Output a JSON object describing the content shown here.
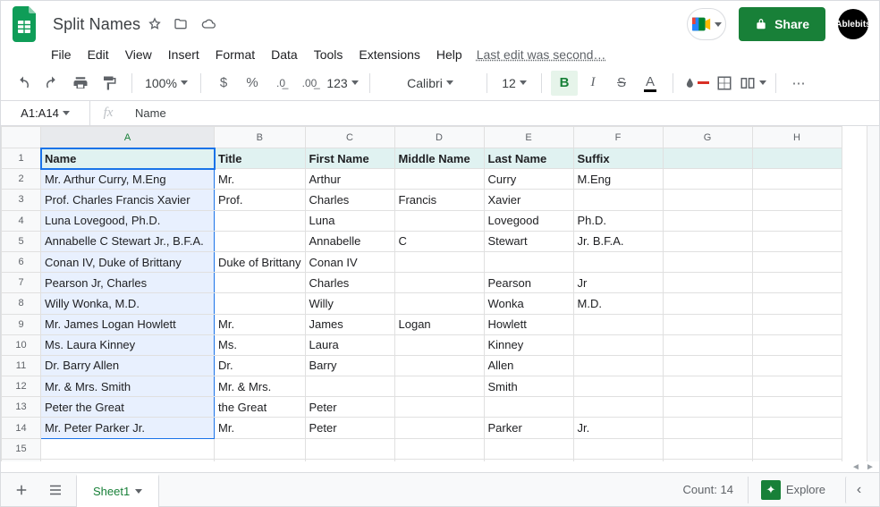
{
  "doc": {
    "title": "Split Names",
    "last_edit": "Last edit was second…"
  },
  "menu": {
    "file": "File",
    "edit": "Edit",
    "view": "View",
    "insert": "Insert",
    "format": "Format",
    "data": "Data",
    "tools": "Tools",
    "extensions": "Extensions",
    "help": "Help"
  },
  "share": {
    "label": "Share"
  },
  "avatar": {
    "label": "Ablebits"
  },
  "toolbar": {
    "zoom": "100%",
    "format_123": "123",
    "font": "Calibri",
    "font_size": "12",
    "bold": "B",
    "italic": "I",
    "strike": "S",
    "underline": "A",
    "textcolor": "A"
  },
  "namebox": {
    "value": "A1:A14"
  },
  "formula": {
    "value": "Name"
  },
  "grid": {
    "columns": [
      "A",
      "B",
      "C",
      "D",
      "E",
      "F",
      "G",
      "H"
    ],
    "headers": {
      "A": "Name",
      "B": "Title",
      "C": "First Name",
      "D": "Middle Name",
      "E": "Last Name",
      "F": "Suffix"
    },
    "rows": [
      {
        "n": 2,
        "A": "Mr. Arthur Curry, M.Eng",
        "B": "Mr.",
        "C": "Arthur",
        "D": "",
        "E": "Curry",
        "F": "M.Eng"
      },
      {
        "n": 3,
        "A": "Prof. Charles Francis Xavier",
        "B": "Prof.",
        "C": "Charles",
        "D": "Francis",
        "E": "Xavier",
        "F": ""
      },
      {
        "n": 4,
        "A": "Luna Lovegood, Ph.D.",
        "B": "",
        "C": "Luna",
        "D": "",
        "E": "Lovegood",
        "F": "Ph.D."
      },
      {
        "n": 5,
        "A": "Annabelle C Stewart Jr., B.F.A.",
        "B": "",
        "C": "Annabelle",
        "D": "C",
        "E": "Stewart",
        "F": "Jr. B.F.A."
      },
      {
        "n": 6,
        "A": "Conan IV, Duke of Brittany",
        "B": "Duke of Brittany",
        "C": "Conan IV",
        "D": "",
        "E": "",
        "F": ""
      },
      {
        "n": 7,
        "A": "Pearson Jr, Charles",
        "B": "",
        "C": "Charles",
        "D": "",
        "E": "Pearson",
        "F": "Jr"
      },
      {
        "n": 8,
        "A": "Willy Wonka, M.D.",
        "B": "",
        "C": "Willy",
        "D": "",
        "E": "Wonka",
        "F": "M.D."
      },
      {
        "n": 9,
        "A": "Mr. James Logan Howlett",
        "B": "Mr.",
        "C": "James",
        "D": "Logan",
        "E": "Howlett",
        "F": ""
      },
      {
        "n": 10,
        "A": "Ms. Laura Kinney",
        "B": "Ms.",
        "C": "Laura",
        "D": "",
        "E": "Kinney",
        "F": ""
      },
      {
        "n": 11,
        "A": "Dr. Barry Allen",
        "B": "Dr.",
        "C": "Barry",
        "D": "",
        "E": "Allen",
        "F": ""
      },
      {
        "n": 12,
        "A": "Mr. & Mrs. Smith",
        "B": "Mr. & Mrs.",
        "C": "",
        "D": "",
        "E": "Smith",
        "F": ""
      },
      {
        "n": 13,
        "A": "Peter the Great",
        "B": "the Great",
        "C": "Peter",
        "D": "",
        "E": "",
        "F": ""
      },
      {
        "n": 14,
        "A": "Mr. Peter Parker Jr.",
        "B": "Mr.",
        "C": "Peter",
        "D": "",
        "E": "Parker",
        "F": "Jr."
      }
    ],
    "blank_rows": [
      15
    ],
    "selection": "A1:A14",
    "active_cell": "A1"
  },
  "sheet_tab": {
    "name": "Sheet1"
  },
  "statusbar": {
    "count_label": "Count: 14",
    "explore": "Explore"
  }
}
